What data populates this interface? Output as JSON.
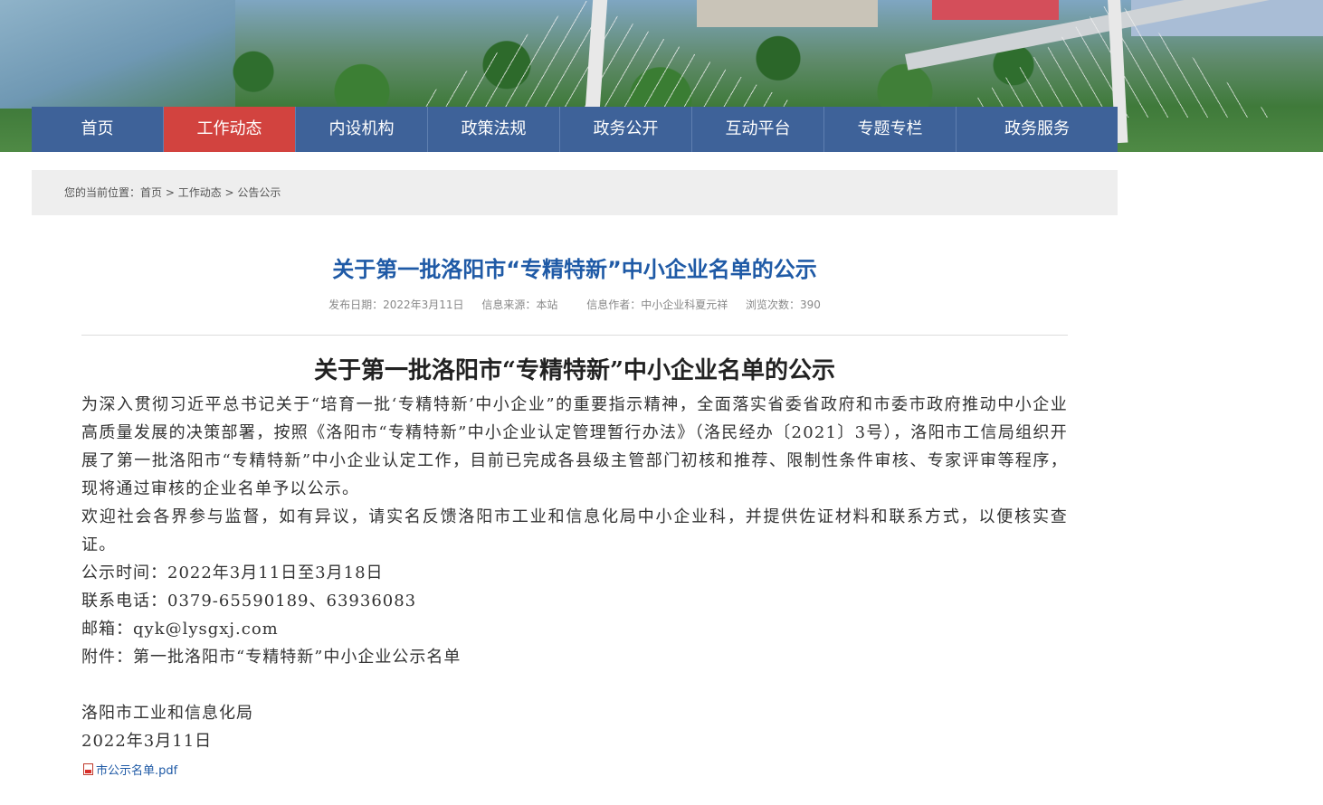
{
  "nav": {
    "items": [
      {
        "label": "首页"
      },
      {
        "label": "工作动态"
      },
      {
        "label": "内设机构"
      },
      {
        "label": "政策法规"
      },
      {
        "label": "政务公开"
      },
      {
        "label": "互动平台"
      },
      {
        "label": "专题专栏"
      },
      {
        "label": "政务服务"
      }
    ],
    "active_index": 1
  },
  "breadcrumb": {
    "prefix": "您的当前位置：",
    "home": "首页",
    "sep1": " > ",
    "section": "工作动态",
    "sep2": " > ",
    "current": "公告公示"
  },
  "article": {
    "title": "关于第一批洛阳市“专精特新”中小企业名单的公示",
    "meta": {
      "date": "发布日期：2022年3月11日",
      "source": "信息来源：本站",
      "author": "信息作者：中小企业科夏元祥",
      "views": "浏览次数：390"
    },
    "content_title": "关于第一批洛阳市“专精特新”中小企业名单的公示",
    "para1": "为深入贯彻习近平总书记关于“培育一批‘专精特新’中小企业”的重要指示精神，全面落实省委省政府和市委市政府推动中小企业高质量发展的决策部署，按照《洛阳市“专精特新”中小企业认定管理暂行办法》（洛民经办〔2021〕3号），洛阳市工信局组织开展了第一批洛阳市“专精特新”中小企业认定工作，目前已完成各县级主管部门初核和推荐、限制性条件审核、专家评审等程序，现将通过审核的企业名单予以公示。",
    "para2": "欢迎社会各界参与监督，如有异议，请实名反馈洛阳市工业和信息化局中小企业科，并提供佐证材料和联系方式，以便核实查证。",
    "period": "公示时间：2022年3月11日至3月18日",
    "phone": "联系电话：0379-65590189、63936083",
    "email": "邮箱：qyk@lysgxj.com",
    "attachment_line": "附件：第一批洛阳市“专精特新”中小企业公示名单",
    "signature": "洛阳市工业和信息化局",
    "sign_date": "2022年3月11日",
    "attachment_link": "市公示名单.pdf",
    "attachment_icon": "pdf-file-icon"
  },
  "colors": {
    "nav_bg": "#3e6299",
    "nav_active": "#d2433f",
    "title": "#1f5aa6",
    "breadcrumb_bg": "#eeeeee"
  }
}
